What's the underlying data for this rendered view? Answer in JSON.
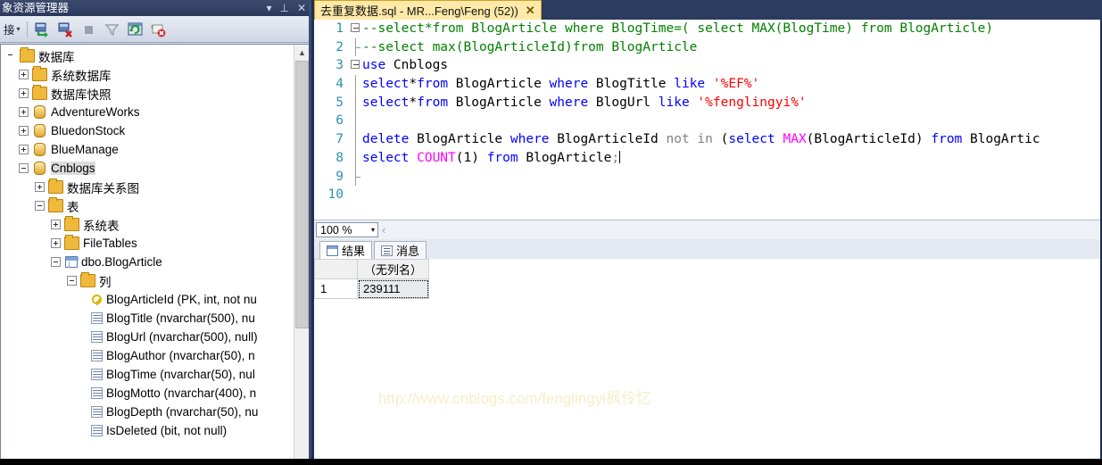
{
  "explorer": {
    "title": "象资源管理器",
    "title_buttons": [
      {
        "name": "dropdown-icon",
        "glyph": "▾"
      },
      {
        "name": "pin-icon",
        "glyph": "⊥"
      },
      {
        "name": "close-icon",
        "glyph": "✕"
      }
    ],
    "toolbar": {
      "connect_label": "接",
      "connect_caret": "▾",
      "buttons": [
        {
          "name": "connect-object-explorer-button"
        },
        {
          "name": "disconnect-object-explorer-button"
        },
        {
          "name": "stop-button"
        },
        {
          "name": "filter-button"
        },
        {
          "name": "refresh-button"
        },
        {
          "name": "script-error-button"
        }
      ]
    },
    "tree": [
      {
        "label": "数据库",
        "indent": 0,
        "expander": "none",
        "icon": "folder"
      },
      {
        "label": "系统数据库",
        "indent": 1,
        "expander": "plus",
        "icon": "folder"
      },
      {
        "label": "数据库快照",
        "indent": 1,
        "expander": "plus",
        "icon": "folder"
      },
      {
        "label": "AdventureWorks",
        "indent": 1,
        "expander": "plus",
        "icon": "db"
      },
      {
        "label": "BluedonStock",
        "indent": 1,
        "expander": "plus",
        "icon": "db"
      },
      {
        "label": "BlueManage",
        "indent": 1,
        "expander": "plus",
        "icon": "db"
      },
      {
        "label": "Cnblogs",
        "indent": 1,
        "expander": "minus",
        "icon": "db",
        "selected": true
      },
      {
        "label": "数据库关系图",
        "indent": 2,
        "expander": "plus",
        "icon": "folder"
      },
      {
        "label": "表",
        "indent": 2,
        "expander": "minus",
        "icon": "folder"
      },
      {
        "label": "系统表",
        "indent": 3,
        "expander": "plus",
        "icon": "folder"
      },
      {
        "label": "FileTables",
        "indent": 3,
        "expander": "plus",
        "icon": "folder"
      },
      {
        "label": "dbo.BlogArticle",
        "indent": 3,
        "expander": "minus",
        "icon": "tbl"
      },
      {
        "label": "列",
        "indent": 4,
        "expander": "minus",
        "icon": "folder"
      },
      {
        "label": "BlogArticleId (PK, int, not nu",
        "indent": 5,
        "expander": "none",
        "icon": "key"
      },
      {
        "label": "BlogTitle (nvarchar(500), nu",
        "indent": 5,
        "expander": "none",
        "icon": "col"
      },
      {
        "label": "BlogUrl (nvarchar(500), null)",
        "indent": 5,
        "expander": "none",
        "icon": "col"
      },
      {
        "label": "BlogAuthor (nvarchar(50), n",
        "indent": 5,
        "expander": "none",
        "icon": "col"
      },
      {
        "label": "BlogTime (nvarchar(50), nul",
        "indent": 5,
        "expander": "none",
        "icon": "col"
      },
      {
        "label": "BlogMotto (nvarchar(400), n",
        "indent": 5,
        "expander": "none",
        "icon": "col"
      },
      {
        "label": "BlogDepth (nvarchar(50), nu",
        "indent": 5,
        "expander": "none",
        "icon": "col"
      },
      {
        "label": "IsDeleted (bit, not null)",
        "indent": 5,
        "expander": "none",
        "icon": "col"
      }
    ]
  },
  "editor": {
    "tab": {
      "label": "去重复数据.sql - MR...Feng\\Feng (52))",
      "close_glyph": "✕"
    },
    "lines": [
      {
        "n": "1",
        "gutter": "box"
      },
      {
        "n": "2",
        "gutter": "endline"
      },
      {
        "n": "3",
        "gutter": "box"
      },
      {
        "n": "4",
        "gutter": "line"
      },
      {
        "n": "5",
        "gutter": "line"
      },
      {
        "n": "6",
        "gutter": "line"
      },
      {
        "n": "7",
        "gutter": "line"
      },
      {
        "n": "8",
        "gutter": "line"
      },
      {
        "n": "9",
        "gutter": "endline"
      },
      {
        "n": "10",
        "gutter": "none"
      }
    ],
    "code_text": {
      "l1": "--select*from BlogArticle where BlogTime=( select MAX(BlogTime) from BlogArticle)",
      "l2": "--select max(BlogArticleId)from BlogArticle",
      "l3_k": "use",
      "l3_id": " Cnblogs",
      "l4_k1": "select",
      "l4_p1": "*",
      "l4_k2": "from",
      "l4_id1": " BlogArticle ",
      "l4_k3": "where",
      "l4_id2": " BlogTitle ",
      "l4_k4": "like",
      "l4_str": " '%EF%'",
      "l5_k1": "select",
      "l5_p1": "*",
      "l5_k2": "from",
      "l5_id1": " BlogArticle ",
      "l5_k3": "where",
      "l5_id2": " BlogUrl ",
      "l5_k4": "like",
      "l5_str": " '%fenglingyi%'",
      "l7_k1": "delete",
      "l7_id1": " BlogArticle ",
      "l7_k2": "where",
      "l7_id2": " BlogArticleId ",
      "l7_k3": "not in",
      "l7_p1": " (",
      "l7_k4": "select",
      "l7_fn": " MAX",
      "l7_p2": "(BlogArticleId) ",
      "l7_k5": "from",
      "l7_id3": " BlogArtic",
      "l8_k1": "select",
      "l8_fn": " COUNT",
      "l8_p1": "(1) ",
      "l8_k2": "from",
      "l8_id1": " BlogArticle",
      "l8_p2": ";"
    }
  },
  "zoombar": {
    "zoom_value": "100 %",
    "caret": "▾",
    "arrow": "‹"
  },
  "result_tabs": [
    {
      "label": "结果",
      "icon": "grid-icon",
      "active": true
    },
    {
      "label": "消息",
      "icon": "message-icon",
      "active": false
    }
  ],
  "result_grid": {
    "corner": "",
    "columns": [
      "（无列名）"
    ],
    "rows": [
      {
        "num": "1",
        "values": [
          "239111"
        ]
      }
    ]
  },
  "watermark": "http://www.cnblogs.com/fenglingyi枫伶忆"
}
